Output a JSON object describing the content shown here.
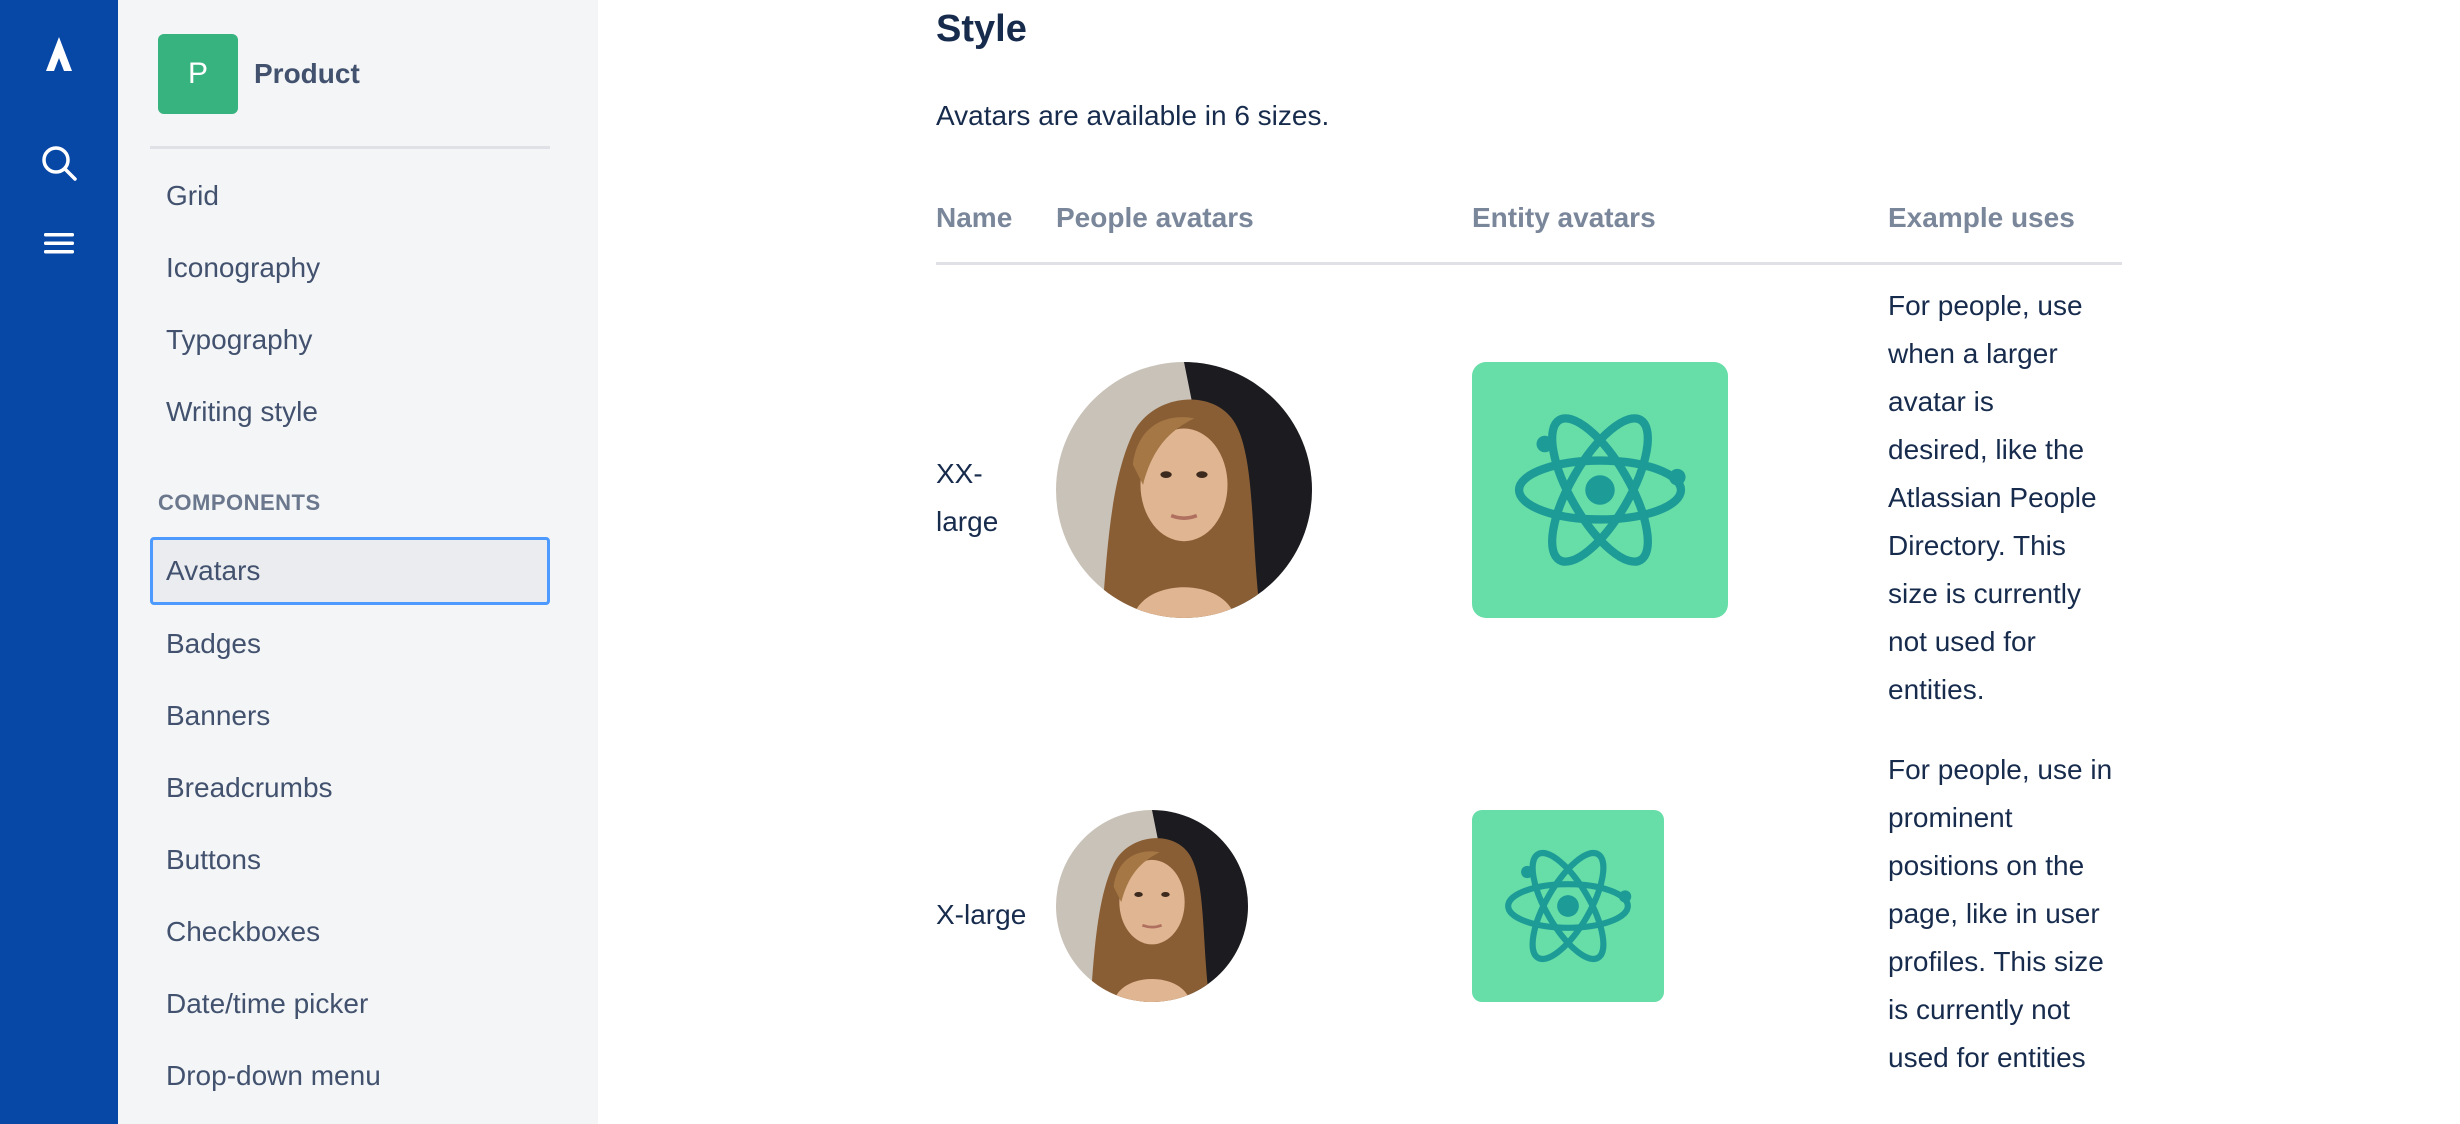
{
  "product": {
    "initial": "P",
    "name": "Product"
  },
  "sidebar": {
    "items": [
      "Grid",
      "Iconography",
      "Typography",
      "Writing style"
    ],
    "section_heading": "COMPONENTS",
    "components": [
      "Avatars",
      "Badges",
      "Banners",
      "Breadcrumbs",
      "Buttons",
      "Checkboxes",
      "Date/time picker",
      "Drop-down menu"
    ],
    "selected": "Avatars"
  },
  "main": {
    "title": "Style",
    "intro": "Avatars are available in 6 sizes.",
    "columns": [
      "Name",
      "People avatars",
      "Entity avatars",
      "Example uses"
    ],
    "rows": [
      {
        "name_lines": [
          "XX-",
          "large"
        ],
        "uses_lines": [
          "For people, use",
          "when a larger",
          "avatar is",
          "desired, like the",
          "Atlassian People",
          "Directory. This",
          "size is currently",
          "not used for",
          "entities."
        ]
      },
      {
        "name_lines": [
          "X-large"
        ],
        "uses_lines": [
          "For people, use in",
          "prominent",
          "positions on the",
          "page, like in user",
          "profiles. This size",
          "is currently not",
          "used for entities"
        ]
      }
    ]
  },
  "colors": {
    "rail": "#0747a6",
    "sidebar_bg": "#f4f5f7",
    "product_avatar": "#36b37e",
    "entity_avatar_bg": "#67dda8",
    "entity_icon": "#1d9b96",
    "selected_border": "#4c9aff"
  },
  "icons": {
    "rail": [
      "atlassian-logo-icon",
      "search-icon",
      "hamburger-menu-icon"
    ],
    "entity": "atom-icon"
  }
}
